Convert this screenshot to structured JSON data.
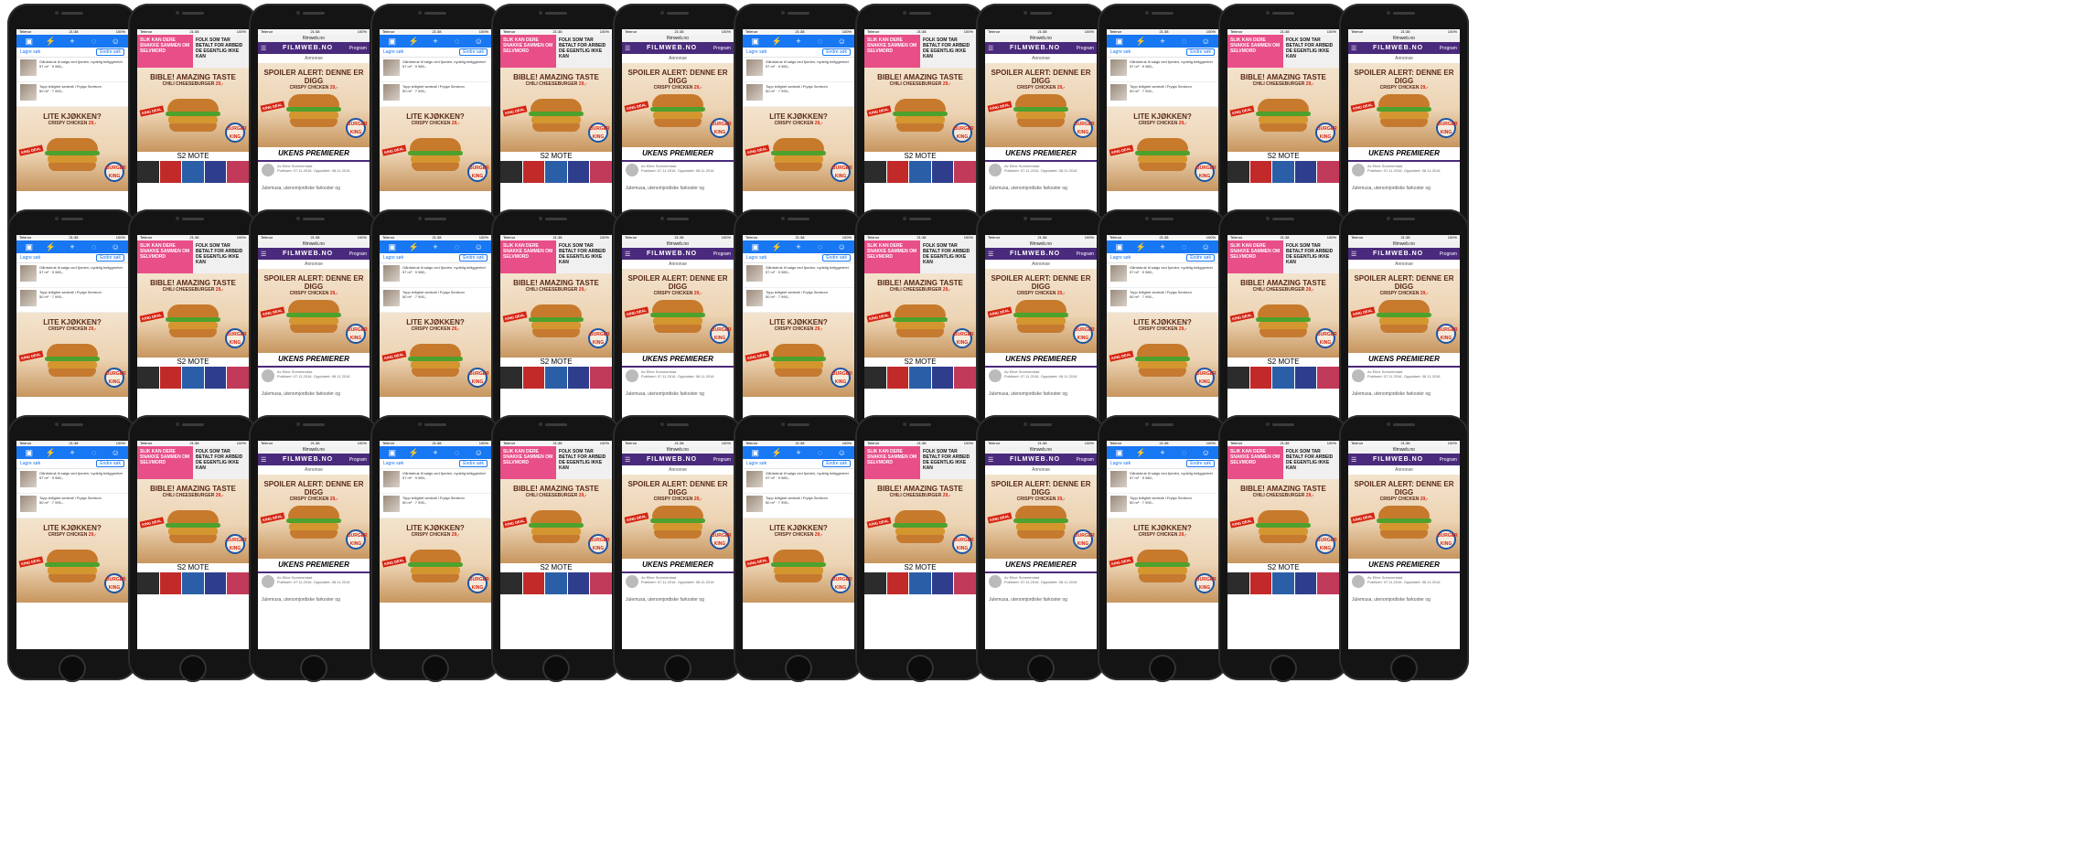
{
  "screens": [
    {
      "variant": "facebook",
      "status": {
        "carrier": "Telenor",
        "time": "21:38",
        "battery": "100%"
      },
      "sub_left": "Lagre søk",
      "sub_right": "Endre søk",
      "feed": [
        {
          "text": "Gårdsbruk til salgs ved fjorden, nydelig beliggenhet",
          "price": "57 m² · 9 980,-"
        },
        {
          "text": "Topp leilighet sentralt i Frysja Sentrum",
          "price": "50 m² · 7 990,-"
        }
      ],
      "ad": {
        "title": "LITE KJØKKEN?",
        "sub": "CRISPY CHICKEN",
        "price": "29,-",
        "burst": "KING DEAL",
        "logo_top": "BURGER",
        "logo_bottom": "KING"
      }
    },
    {
      "variant": "magazine",
      "status": {
        "carrier": "Telenor",
        "time": "21:38",
        "battery": "100%"
      },
      "pink_left": "SLIK KAN DERE SNAKKE SAMMEN OM SELVMORD",
      "pink_right": "FOLK SOM TAR BETALT FOR ARBEID DE EGENTLIG IKKE KAN",
      "ad": {
        "title": "BIBLE! AMAZING TASTE",
        "sub": "CHILI CHEESEBURGER",
        "price": "29,-",
        "burst": "KING DEAL",
        "logo_top": "BURGER",
        "logo_bottom": "KING"
      },
      "mote": "S2 MOTE"
    },
    {
      "variant": "filmweb",
      "status": {
        "carrier": "Telenor",
        "time": "21:38",
        "battery": "100%"
      },
      "url": "filmweb.no",
      "logo": "FILMWEB.NO",
      "program": "Program",
      "annonse": "Annonse",
      "ad": {
        "title": "SPOILER ALERT: DENNE ER DIGG",
        "sub": "CRISPY CHICKEN",
        "price": "29,-",
        "burst": "KING DEAL",
        "logo_top": "BURGER",
        "logo_bottom": "KING"
      },
      "section_title": "UKENS PREMIERER",
      "author": "Av Eline Sommerstad",
      "published": "Publisert: 07.11.2016. Oppdatert: 08.11.2016",
      "footer": "Julemusa, utenomjordiske farkoster og"
    }
  ]
}
